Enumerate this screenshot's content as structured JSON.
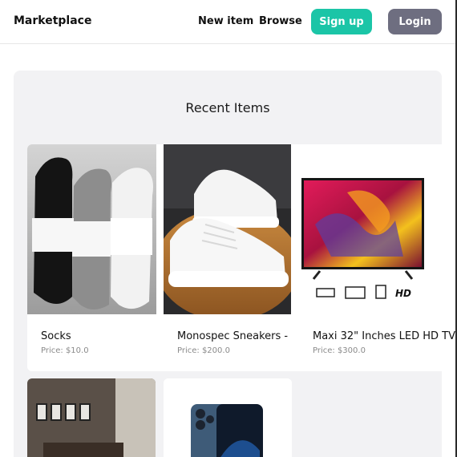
{
  "header": {
    "brand": "Marketplace",
    "nav": {
      "new_item": "New item",
      "browse": "Browse"
    },
    "signup_label": "Sign up",
    "login_label": "Login"
  },
  "main": {
    "title": "Recent Items",
    "items": [
      {
        "name": "Socks",
        "price": "Price: $10.0",
        "image": "socks-photo"
      },
      {
        "name": "Monospec Sneakers - W",
        "price": "Price: $200.0",
        "image": "sneakers-photo"
      },
      {
        "name": "Maxi 32\" Inches LED HD TV",
        "price": "Price: $300.0",
        "image": "tv-photo"
      },
      {
        "name": "",
        "price": "",
        "image": "bedroom-photo"
      },
      {
        "name": "",
        "price": "",
        "image": "phone-photo"
      }
    ]
  },
  "colors": {
    "accent": "#1bc5a7",
    "login_button": "#6e6e80",
    "panel_background": "#f2f2f4",
    "price_text": "#8a8a8a"
  }
}
